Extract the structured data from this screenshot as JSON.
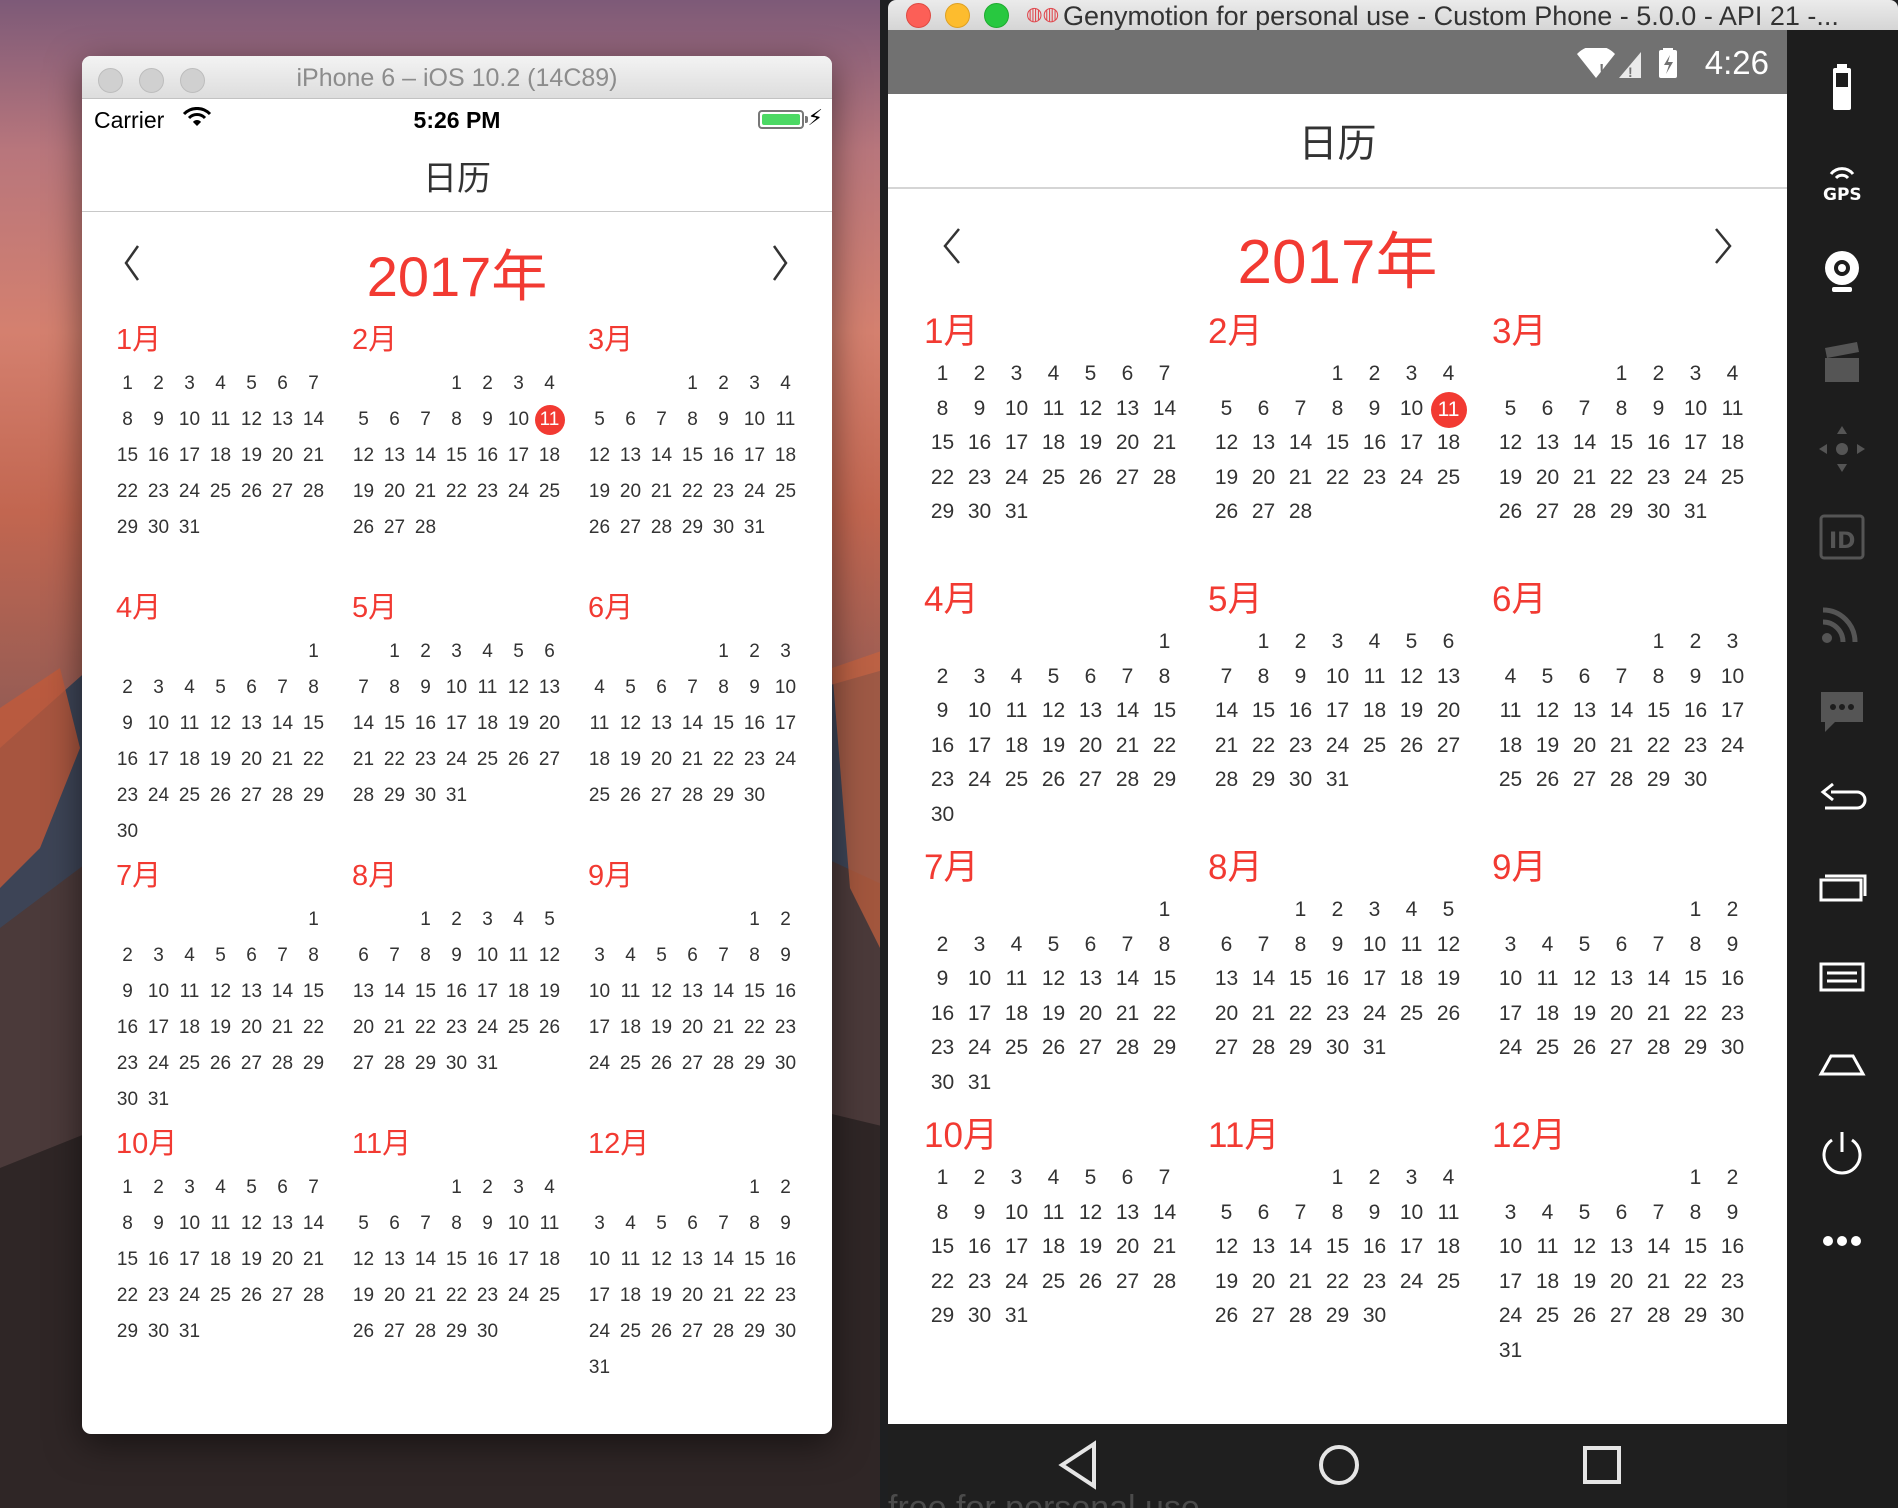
{
  "ios": {
    "window_title": "iPhone 6 – iOS 10.2 (14C89)",
    "status": {
      "carrier": "Carrier",
      "time": "5:26 PM"
    },
    "nav_title": "日历",
    "year_label": "2017年"
  },
  "genymotion": {
    "window_title": "Genymotion for personal use - Custom Phone - 5.0.0 - API 21 -...",
    "status_time": "4:26",
    "nav_title": "日历",
    "year_label": "2017年",
    "watermark": "free for personal use",
    "sidebar_icons": [
      "battery-icon",
      "gps-icon",
      "webcam-icon",
      "clapper-icon",
      "dpad-icon",
      "id-icon",
      "rss-icon",
      "sms-icon",
      "back-icon",
      "recent-apps-icon",
      "menu-icon",
      "home-icon",
      "power-icon",
      "more-icon"
    ]
  },
  "calendar": {
    "year": 2017,
    "today": {
      "month": 2,
      "day": 11
    },
    "accent_color": "#f23a32",
    "months": [
      {
        "name": "1月",
        "offset": 0,
        "days": 31
      },
      {
        "name": "2月",
        "offset": 3,
        "days": 28
      },
      {
        "name": "3月",
        "offset": 3,
        "days": 31
      },
      {
        "name": "4月",
        "offset": 6,
        "days": 30
      },
      {
        "name": "5月",
        "offset": 1,
        "days": 31
      },
      {
        "name": "6月",
        "offset": 4,
        "days": 30
      },
      {
        "name": "7月",
        "offset": 6,
        "days": 31
      },
      {
        "name": "8月",
        "offset": 2,
        "days": 31
      },
      {
        "name": "9月",
        "offset": 5,
        "days": 30
      },
      {
        "name": "10月",
        "offset": 0,
        "days": 31
      },
      {
        "name": "11月",
        "offset": 3,
        "days": 30
      },
      {
        "name": "12月",
        "offset": 5,
        "days": 31
      }
    ]
  }
}
